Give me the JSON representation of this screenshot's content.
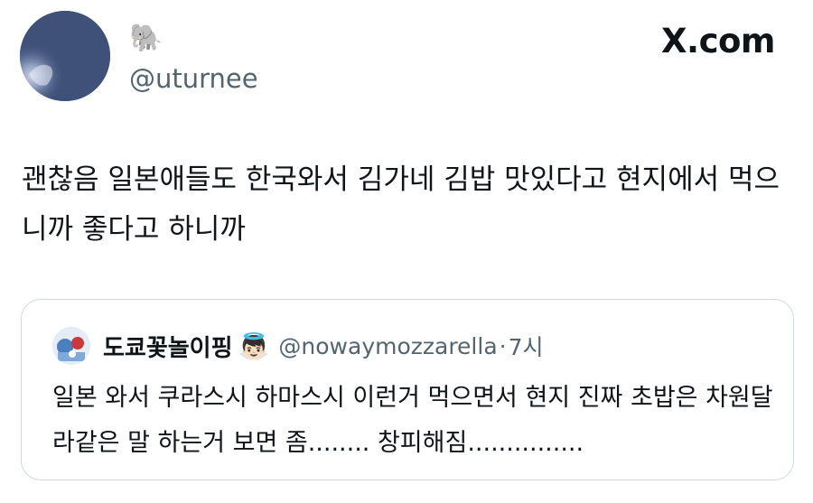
{
  "brand": {
    "label": "X.com"
  },
  "author": {
    "display_name": "🐘",
    "handle": "@uturnee"
  },
  "tweet": {
    "text": "괜찮음 일본애들도 한국와서 김가네 김밥 맛있다고 현지에서 먹으니까 좋다고 하니까"
  },
  "quoted_tweet": {
    "display_name": "도쿄꽃놀이핑",
    "name_emoji": "👼🏻",
    "handle": "@nowaymozzarella",
    "separator": "·",
    "time": "7시",
    "text": "일본 와서 쿠라스시 하마스시 이런거 먹으면서 현지 진짜 초밥은 차원달라같은 말 하는거 보면 좀........ 창피해짐..............."
  },
  "icons": {
    "avatar": "elephant-profile-photo",
    "quoted_avatar": "anime-profile-photo"
  }
}
